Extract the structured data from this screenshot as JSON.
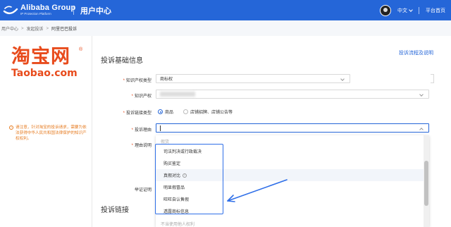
{
  "header": {
    "brand_name": "Alibaba Group",
    "brand_sub": "IP Protection Platform",
    "title": "用户中心",
    "lang": "中文",
    "home_link": "平台首页",
    "color": "#2566d8"
  },
  "breadcrumb": {
    "items": [
      "用户中心",
      "发起投诉",
      "阿里巴巴投诉"
    ]
  },
  "sidebar": {
    "logo_cn": "淘宝网",
    "logo_reg": "®",
    "logo_en": "Taobao.com",
    "notice_icon": "!",
    "notice": "请注意，针对淘宝的投诉请求，需要为依法获得中华人民共和国法律保护的知识产权权利。"
  },
  "main": {
    "section1_title": "投诉基础信息",
    "help_link": "投诉流程及说明",
    "ip_type_label": "知识产权类型",
    "ip_type_value": "商标权",
    "ip_label": "知识产权",
    "link_type_label": "投诉链接类型",
    "link_type_options": [
      "商品",
      "店铺招牌、店铺公告等"
    ],
    "reason_label": "投诉理由",
    "reason_desc_label": "理由说明",
    "evidence_label": "举证证明",
    "section2_title": "投诉链接"
  },
  "dropdown": {
    "group_label": "假货",
    "items": [
      "司法判决或行政裁决",
      "购买鉴定",
      "真假对比",
      "明显假冒品",
      "旺旺自认售假",
      "透露商标信息"
    ],
    "item_help_icon": "?",
    "footer": "不当使用他人权利"
  }
}
